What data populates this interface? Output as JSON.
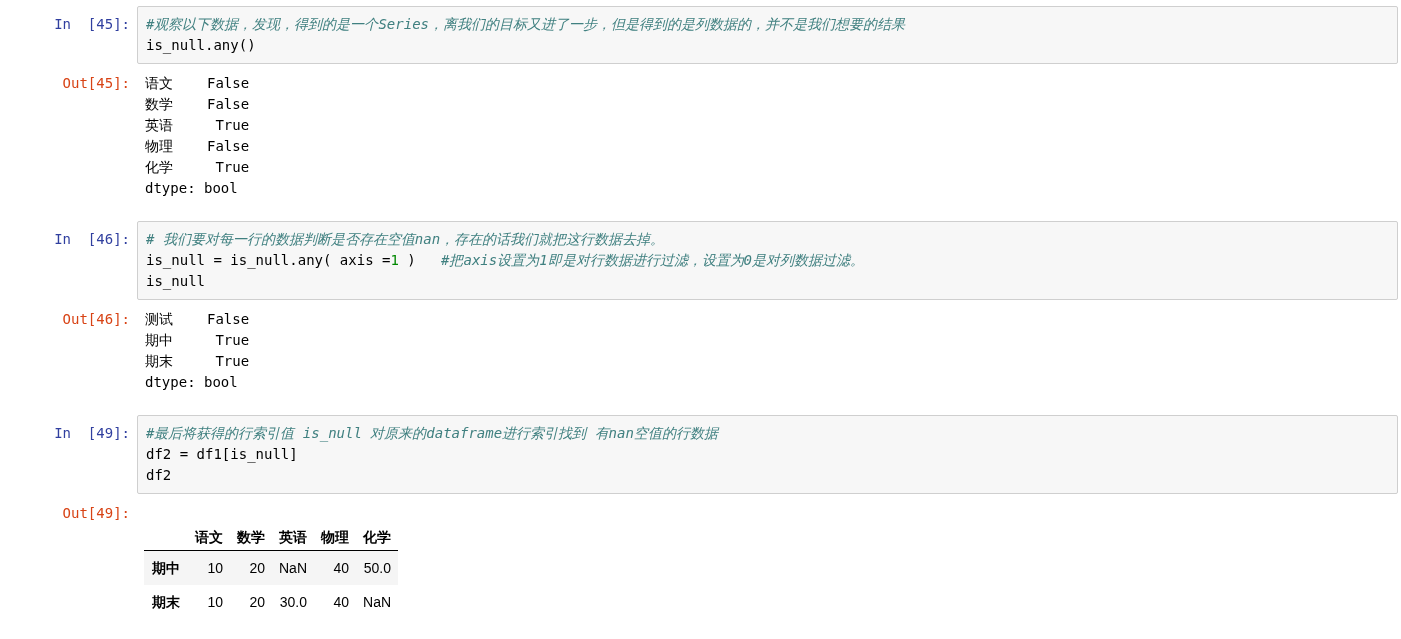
{
  "cells": [
    {
      "in_prompt": "In  [45]:",
      "source": [
        [
          {
            "kind": "comment",
            "text": "#观察以下数据，发现，得到的是一个Series，离我们的目标又进了一步，但是得到的是列数据的，并不是我们想要的结果"
          }
        ],
        [
          {
            "kind": "code",
            "text": "is_null.any()"
          }
        ]
      ],
      "output": {
        "prompt": "Out[45]:",
        "kind": "series",
        "rows": [
          {
            "index": "语文",
            "value": "False"
          },
          {
            "index": "数学",
            "value": "False"
          },
          {
            "index": "英语",
            "value": "True"
          },
          {
            "index": "物理",
            "value": "False"
          },
          {
            "index": "化学",
            "value": "True"
          }
        ],
        "dtype": "dtype: bool"
      }
    },
    {
      "in_prompt": "In  [46]:",
      "source": [
        [
          {
            "kind": "comment",
            "text": "# 我们要对每一行的数据判断是否存在空值nan，存在的话我们就把这行数据去掉。"
          }
        ],
        [
          {
            "kind": "code",
            "text": "is_null = is_null.any( axis ="
          },
          {
            "kind": "number",
            "text": "1"
          },
          {
            "kind": "code",
            "text": " )   "
          },
          {
            "kind": "comment",
            "text": "#把axis设置为1即是对行数据进行过滤，设置为0是对列数据过滤。"
          }
        ],
        [
          {
            "kind": "code",
            "text": "is_null"
          }
        ]
      ],
      "output": {
        "prompt": "Out[46]:",
        "kind": "series",
        "rows": [
          {
            "index": "测试",
            "value": "False"
          },
          {
            "index": "期中",
            "value": "True"
          },
          {
            "index": "期末",
            "value": "True"
          }
        ],
        "dtype": "dtype: bool"
      }
    },
    {
      "in_prompt": "In  [49]:",
      "source": [
        [
          {
            "kind": "comment",
            "text": "#最后将获得的行索引值 is_null 对原来的dataframe进行索引找到 有nan空值的行数据"
          }
        ],
        [
          {
            "kind": "code",
            "text": "df2 = df1[is_null]"
          }
        ],
        [
          {
            "kind": "code",
            "text": "df2"
          }
        ]
      ],
      "output": {
        "prompt": "Out[49]:",
        "kind": "dataframe",
        "columns": [
          "语文",
          "数学",
          "英语",
          "物理",
          "化学"
        ],
        "rows": [
          {
            "index": "期中",
            "values": [
              "10",
              "20",
              "NaN",
              "40",
              "50.0"
            ]
          },
          {
            "index": "期末",
            "values": [
              "10",
              "20",
              "30.0",
              "40",
              "NaN"
            ]
          }
        ]
      }
    }
  ]
}
